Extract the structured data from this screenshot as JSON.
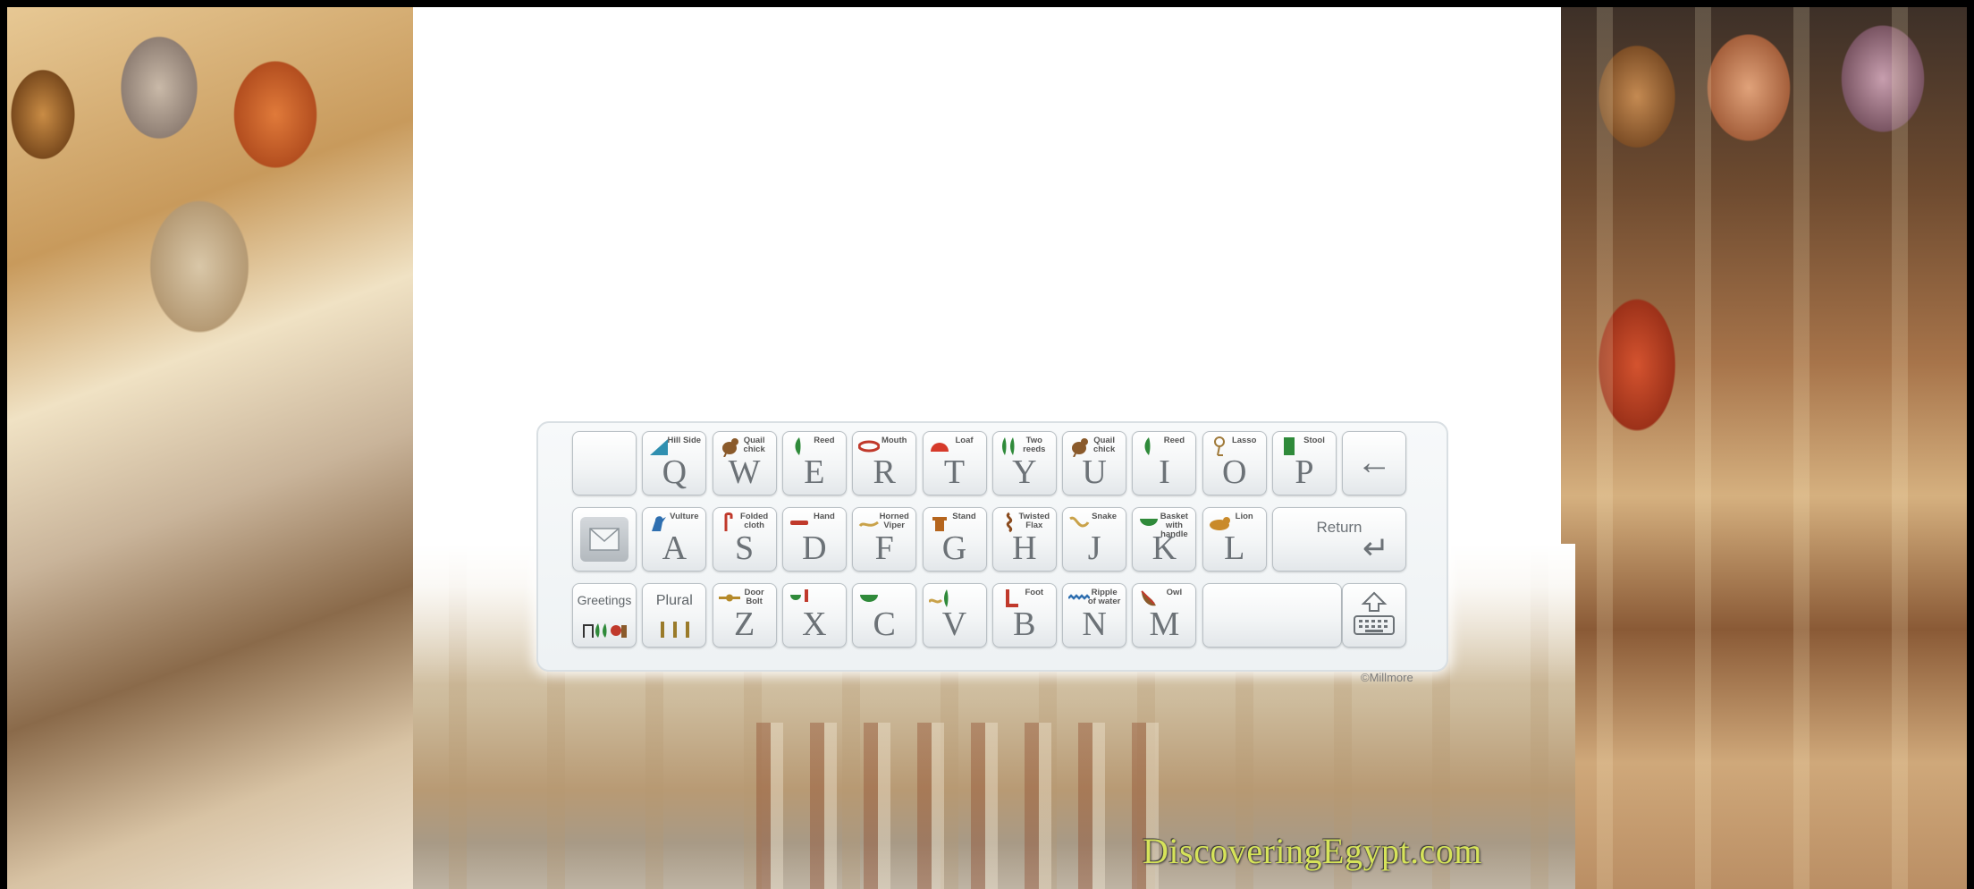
{
  "brand": {
    "site": "DiscoveringEgypt.com",
    "credit": "©Millmore"
  },
  "keyboard": {
    "row1": [
      {
        "letter": "Q",
        "sign": "Hill Side",
        "icon": "hill-side-icon",
        "color": "#2f8fb0"
      },
      {
        "letter": "W",
        "sign": "Quail chick",
        "icon": "quail-chick-icon",
        "color": "#8a5a2b"
      },
      {
        "letter": "E",
        "sign": "Reed",
        "icon": "reed-icon",
        "color": "#2f8a3a"
      },
      {
        "letter": "R",
        "sign": "Mouth",
        "icon": "mouth-icon",
        "color": "#c0392b"
      },
      {
        "letter": "T",
        "sign": "Loaf",
        "icon": "loaf-icon",
        "color": "#d63a2a"
      },
      {
        "letter": "Y",
        "sign": "Two reeds",
        "icon": "two-reeds-icon",
        "color": "#2f8a3a"
      },
      {
        "letter": "U",
        "sign": "Quail chick",
        "icon": "quail-chick-icon",
        "color": "#8a5a2b"
      },
      {
        "letter": "I",
        "sign": "Reed",
        "icon": "reed-icon",
        "color": "#2f8a3a"
      },
      {
        "letter": "O",
        "sign": "Lasso",
        "icon": "lasso-icon",
        "color": "#a07a3a"
      },
      {
        "letter": "P",
        "sign": "Stool",
        "icon": "stool-icon",
        "color": "#2f8a3a"
      }
    ],
    "row2": [
      {
        "letter": "A",
        "sign": "Vulture",
        "icon": "vulture-icon",
        "color": "#2f6fb0"
      },
      {
        "letter": "S",
        "sign": "Folded cloth",
        "icon": "folded-cloth-icon",
        "color": "#c0392b"
      },
      {
        "letter": "D",
        "sign": "Hand",
        "icon": "hand-icon",
        "color": "#c0392b"
      },
      {
        "letter": "F",
        "sign": "Horned Viper",
        "icon": "horned-viper-icon",
        "color": "#c9a24a"
      },
      {
        "letter": "G",
        "sign": "Stand",
        "icon": "stand-icon",
        "color": "#b5651d"
      },
      {
        "letter": "H",
        "sign": "Twisted Flax",
        "icon": "twisted-flax-icon",
        "color": "#8a4a1d"
      },
      {
        "letter": "J",
        "sign": "Snake",
        "icon": "snake-icon",
        "color": "#c9a24a"
      },
      {
        "letter": "K",
        "sign": "Basket with handle",
        "icon": "basket-icon",
        "color": "#2f8a3a"
      },
      {
        "letter": "L",
        "sign": "Lion",
        "icon": "lion-icon",
        "color": "#c98a2a"
      }
    ],
    "row3": [
      {
        "letter": "Z",
        "sign": "Door Bolt",
        "icon": "door-bolt-icon",
        "color": "#b58a2a"
      },
      {
        "letter": "X",
        "sign": "",
        "icon": "basket-bread-icon",
        "color": "#2f8a3a"
      },
      {
        "letter": "C",
        "sign": "",
        "icon": "basket-icon",
        "color": "#2f8a3a"
      },
      {
        "letter": "V",
        "sign": "",
        "icon": "viper-reed-icon",
        "color": "#c9a24a"
      },
      {
        "letter": "B",
        "sign": "Foot",
        "icon": "foot-icon",
        "color": "#c0392b"
      },
      {
        "letter": "N",
        "sign": "Ripple of water",
        "icon": "water-icon",
        "color": "#2f6fb0"
      },
      {
        "letter": "M",
        "sign": "Owl",
        "icon": "owl-icon",
        "color": "#8a5a2b"
      }
    ],
    "return_label": "Return",
    "greetings_label": "Greetings",
    "plural_label": "Plural",
    "backspace_symbol": "←",
    "return_symbol": "↵"
  }
}
